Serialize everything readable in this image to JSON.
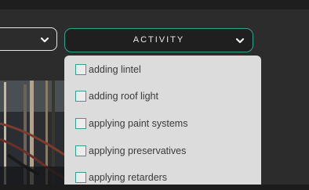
{
  "filters": {
    "activity": {
      "label": "ACTIVITY",
      "expanded": true,
      "accent_color": "#2fa391",
      "options": [
        {
          "label": "adding lintel",
          "checked": false
        },
        {
          "label": "adding roof light",
          "checked": false
        },
        {
          "label": "applying paint systems",
          "checked": false
        },
        {
          "label": "applying preservatives",
          "checked": false
        },
        {
          "label": "applying retarders",
          "checked": false
        }
      ]
    },
    "left_dropdown": {
      "icon": "chevron-down-icon"
    }
  }
}
